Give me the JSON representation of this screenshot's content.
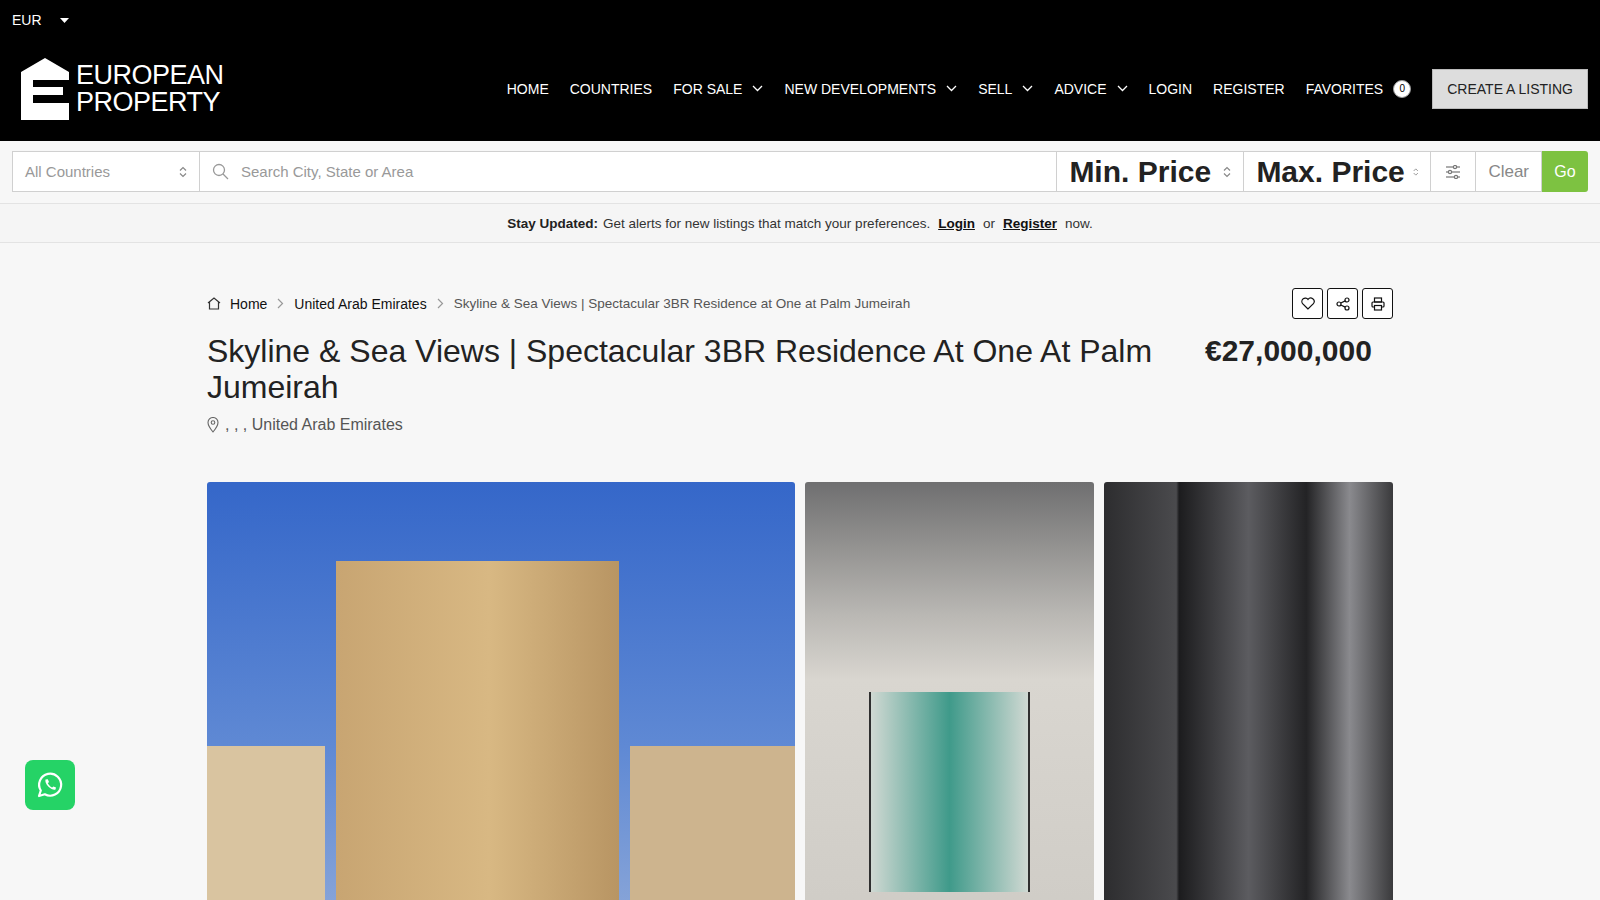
{
  "currency": {
    "label": "EUR"
  },
  "logo": {
    "line1": "EUROPEAN",
    "line2": "PROPERTY"
  },
  "nav": [
    {
      "label": "HOME",
      "dropdown": false
    },
    {
      "label": "COUNTRIES",
      "dropdown": false
    },
    {
      "label": "FOR SALE",
      "dropdown": true
    },
    {
      "label": "NEW DEVELOPMENTS",
      "dropdown": true
    },
    {
      "label": "SELL",
      "dropdown": true
    },
    {
      "label": "ADVICE",
      "dropdown": true
    },
    {
      "label": "LOGIN",
      "dropdown": false
    },
    {
      "label": "REGISTER",
      "dropdown": false
    }
  ],
  "favorites": {
    "label": "FAVORITES",
    "count": "0"
  },
  "create_listing": "CREATE A LISTING",
  "search": {
    "country": "All Countries",
    "query_placeholder": "Search City, State or Area",
    "min_price": "Min. Price",
    "max_price": "Max. Price",
    "clear": "Clear",
    "go": "Go"
  },
  "alert_bar": {
    "lead": "Stay Updated:",
    "text": "Get alerts for new listings that match your preferences.",
    "login": "Login",
    "or": "or",
    "register": "Register",
    "end": "now."
  },
  "breadcrumb": [
    {
      "label": "Home",
      "current": false
    },
    {
      "label": "United Arab Emirates",
      "current": false
    },
    {
      "label": "Skyline & Sea Views | Spectacular 3BR Residence at One at Palm Jumeirah",
      "current": true
    }
  ],
  "listing": {
    "title": "Skyline & Sea Views | Spectacular 3BR Residence At One At Palm Jumeirah",
    "price": "€27,000,000",
    "location": ", , , United Arab Emirates"
  }
}
